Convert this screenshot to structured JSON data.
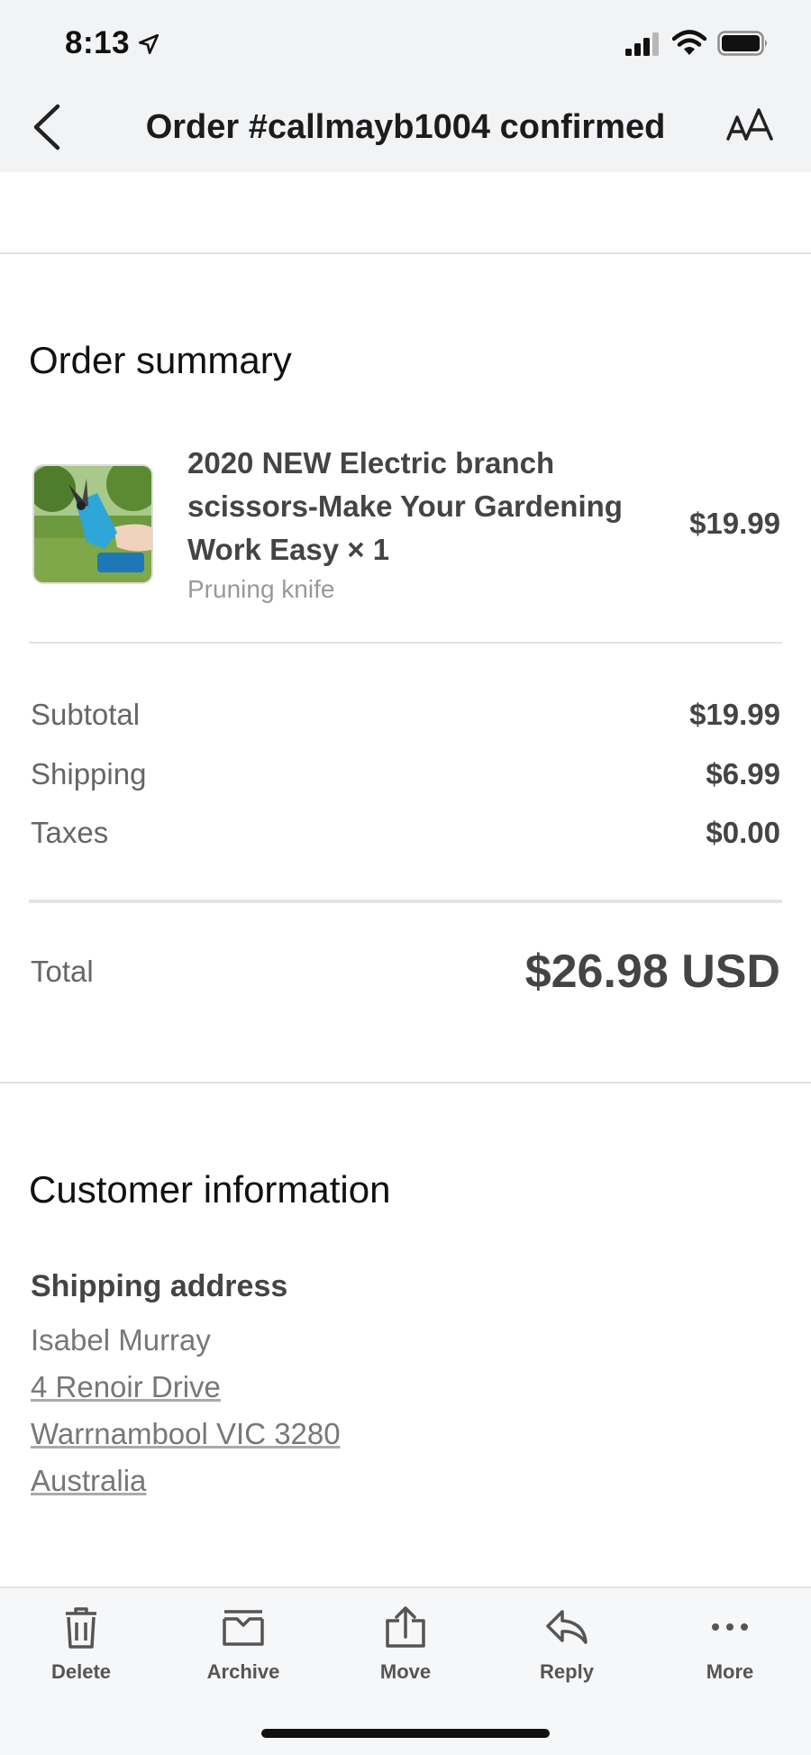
{
  "status_bar": {
    "time": "8:13"
  },
  "header": {
    "title": "Order #callmayb1004 confirmed"
  },
  "order_summary": {
    "heading": "Order summary",
    "item": {
      "name": "2020 NEW Electric branch scissors-Make Your Gardening Work Easy × 1",
      "variant": "Pruning knife",
      "price": "$19.99"
    },
    "rows": [
      {
        "label": "Subtotal",
        "value": "$19.99"
      },
      {
        "label": "Shipping",
        "value": "$6.99"
      },
      {
        "label": "Taxes",
        "value": "$0.00"
      }
    ],
    "total_label": "Total",
    "total_value": "$26.98 USD"
  },
  "customer_information": {
    "heading": "Customer information",
    "shipping_heading": "Shipping address",
    "name": "Isabel Murray",
    "street": "4 Renoir Drive",
    "city": "Warrnambool VIC 3280",
    "country": "Australia"
  },
  "toolbar": {
    "delete": "Delete",
    "archive": "Archive",
    "move": "Move",
    "reply": "Reply",
    "more": "More"
  },
  "colors": {
    "header_bg": "#f2f3f5",
    "text_dark": "#444444",
    "text_muted": "#777777",
    "product_blue": "#2fa6d8"
  },
  "icons": [
    "location-arrow-icon",
    "signal-icon",
    "wifi-icon",
    "battery-icon",
    "back-chevron-icon",
    "text-size-icon",
    "trash-icon",
    "archive-box-icon",
    "move-folder-icon",
    "reply-arrow-icon",
    "more-dots-icon"
  ]
}
